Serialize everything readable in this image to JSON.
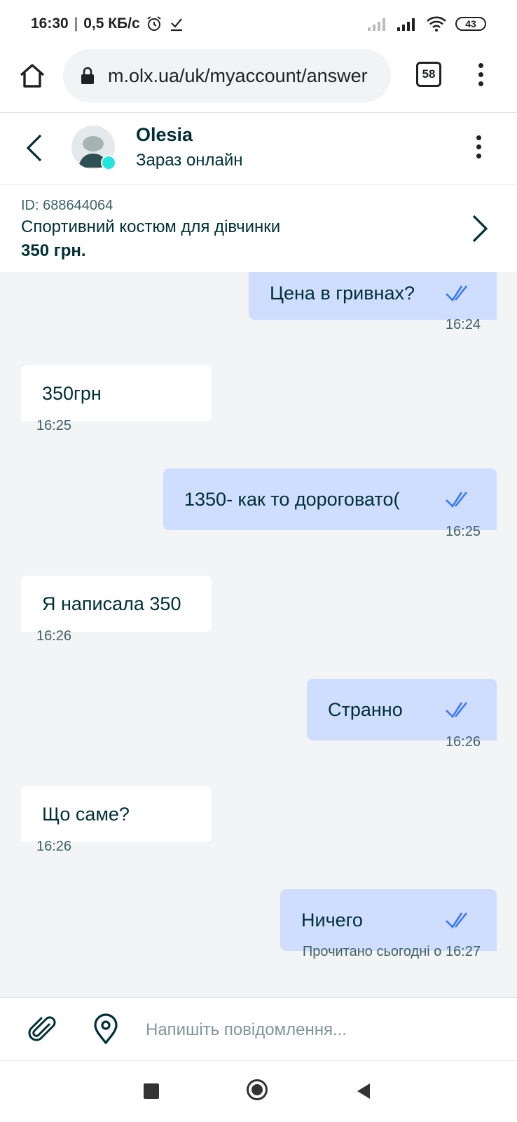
{
  "status_bar": {
    "time": "16:30",
    "speed": "0,5 КБ/с",
    "battery": "43",
    "icons": [
      "alarm-icon",
      "download-done-icon",
      "signal-icon",
      "signal-icon",
      "wifi-icon",
      "battery-icon"
    ]
  },
  "browser": {
    "url": "m.olx.ua/uk/myaccount/answer",
    "tabs_count": "58"
  },
  "chat": {
    "contact_name": "Olesia",
    "contact_status": "Зараз онлайн",
    "online_color": "#23e5db"
  },
  "listing": {
    "id": "ID: 688644064",
    "title": "Спортивний костюм для дівчинки",
    "price": "350 грн."
  },
  "messages": [
    {
      "direction": "out",
      "text": "Цена в гривнах?",
      "time": "16:24"
    },
    {
      "direction": "in",
      "text": "350грн",
      "time": "16:25"
    },
    {
      "direction": "out",
      "text": "1350- как то дороговато(",
      "time": "16:25"
    },
    {
      "direction": "in",
      "text": "Я написала 350",
      "time": "16:26"
    },
    {
      "direction": "out",
      "text": "Странно",
      "time": "16:26"
    },
    {
      "direction": "in",
      "text": "Що саме?",
      "time": "16:26"
    },
    {
      "direction": "out",
      "text": "Ничего",
      "time": "Прочитано сьогодні о 16:27"
    }
  ],
  "composer": {
    "placeholder": "Напишіть повідомлення..."
  },
  "colors": {
    "outgoing_bubble": "#cfdeff",
    "incoming_bubble": "#ffffff",
    "background": "#f2f4f5",
    "read_ticks": "#3a77ff"
  }
}
